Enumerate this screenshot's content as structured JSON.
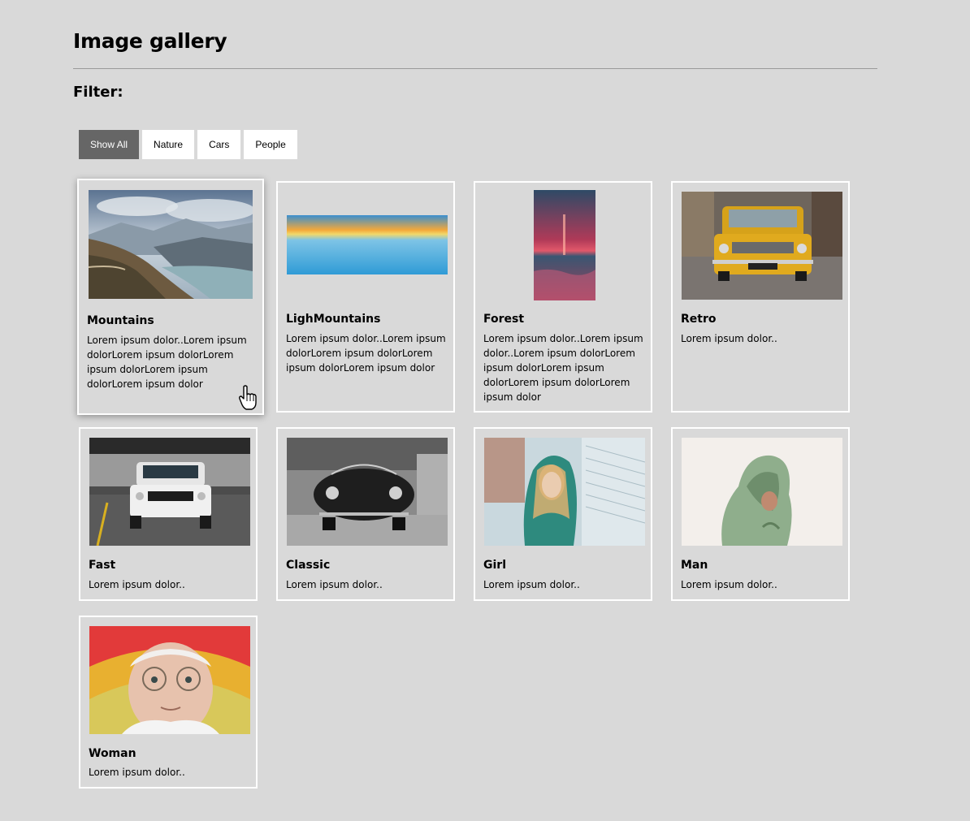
{
  "page": {
    "title": "Image gallery",
    "filter_label": "Filter:"
  },
  "filters": [
    {
      "label": "Show All",
      "active": true
    },
    {
      "label": "Nature",
      "active": false
    },
    {
      "label": "Cars",
      "active": false
    },
    {
      "label": "People",
      "active": false
    }
  ],
  "cards": [
    {
      "title": "Mountains",
      "text": "Lorem ipsum dolor..Lorem ipsum dolorLorem ipsum dolorLorem ipsum dolorLorem ipsum dolorLorem ipsum dolor",
      "image": "mountain-landscape-image"
    },
    {
      "title": "LighMountains",
      "text": "Lorem ipsum dolor..Lorem ipsum dolorLorem ipsum dolorLorem ipsum dolorLorem ipsum dolor",
      "image": "sea-sunset-image"
    },
    {
      "title": "Forest",
      "text": "Lorem ipsum dolor..Lorem ipsum dolor..Lorem ipsum dolorLorem ipsum dolorLorem ipsum dolorLorem ipsum dolorLorem ipsum dolor",
      "image": "ocean-sunset-image"
    },
    {
      "title": "Retro",
      "text": "Lorem ipsum dolor..",
      "image": "yellow-car-image"
    },
    {
      "title": "Fast",
      "text": "Lorem ipsum dolor..",
      "image": "white-mustang-image"
    },
    {
      "title": "Classic",
      "text": "Lorem ipsum dolor..",
      "image": "black-classic-car-image"
    },
    {
      "title": "Girl",
      "text": "Lorem ipsum dolor..",
      "image": "girl-hoodie-image"
    },
    {
      "title": "Man",
      "text": "Lorem ipsum dolor..",
      "image": "man-hoodie-image"
    },
    {
      "title": "Woman",
      "text": "Lorem ipsum dolor..",
      "image": "old-woman-image"
    }
  ],
  "colors": {
    "background": "#d9d9d9",
    "active_filter": "#666666",
    "card_border": "#ffffff"
  }
}
